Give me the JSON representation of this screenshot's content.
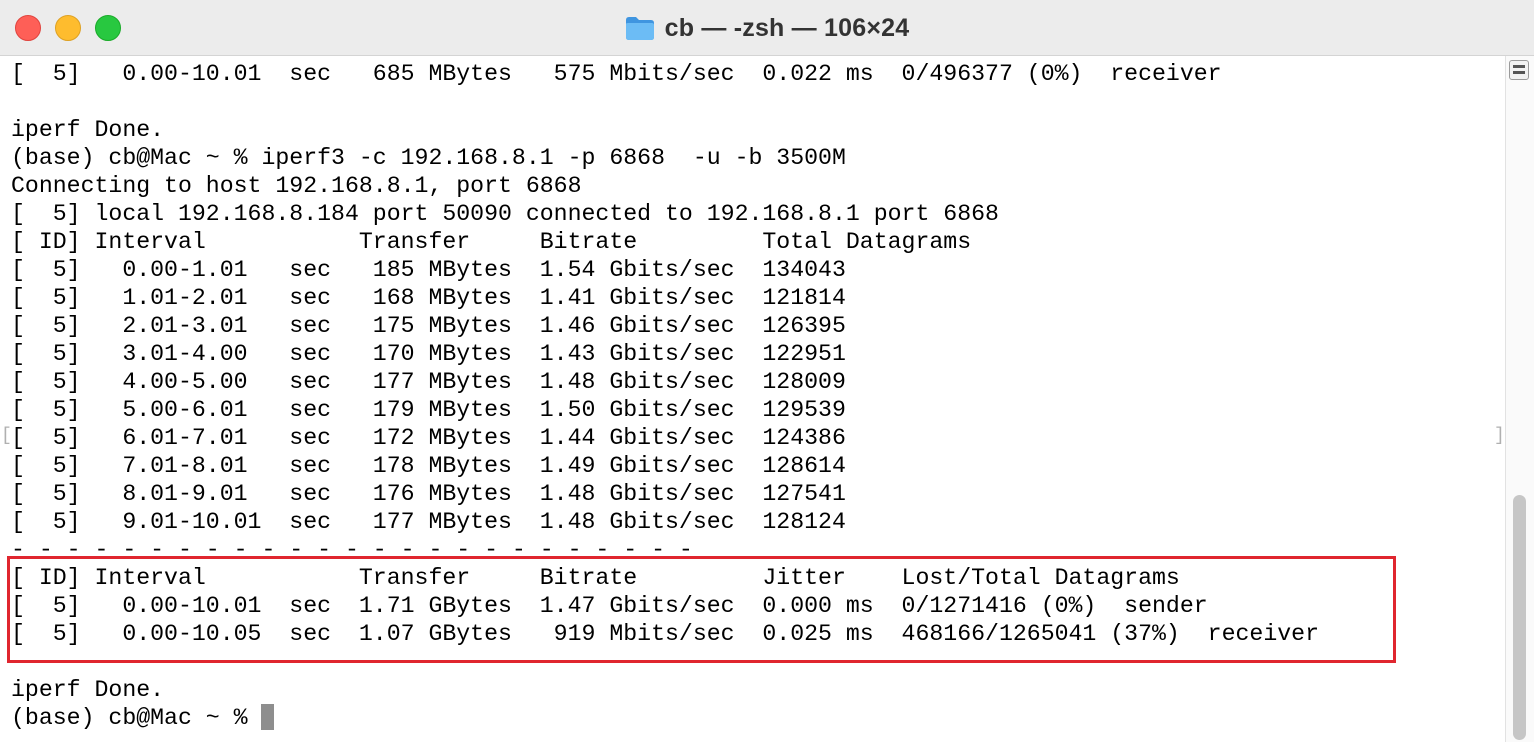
{
  "window": {
    "title": "cb — -zsh — 106×24",
    "icon": "folder-icon"
  },
  "terminal": {
    "lines": [
      "[  5]   0.00-10.01  sec   685 MBytes   575 Mbits/sec  0.022 ms  0/496377 (0%)  receiver",
      "",
      "iperf Done.",
      "(base) cb@Mac ~ % iperf3 -c 192.168.8.1 -p 6868  -u -b 3500M",
      "Connecting to host 192.168.8.1, port 6868",
      "[  5] local 192.168.8.184 port 50090 connected to 192.168.8.1 port 6868",
      "[ ID] Interval           Transfer     Bitrate         Total Datagrams",
      "[  5]   0.00-1.01   sec   185 MBytes  1.54 Gbits/sec  134043",
      "[  5]   1.01-2.01   sec   168 MBytes  1.41 Gbits/sec  121814",
      "[  5]   2.01-3.01   sec   175 MBytes  1.46 Gbits/sec  126395",
      "[  5]   3.01-4.00   sec   170 MBytes  1.43 Gbits/sec  122951",
      "[  5]   4.00-5.00   sec   177 MBytes  1.48 Gbits/sec  128009",
      "[  5]   5.00-6.01   sec   179 MBytes  1.50 Gbits/sec  129539",
      "[  5]   6.01-7.01   sec   172 MBytes  1.44 Gbits/sec  124386",
      "[  5]   7.01-8.01   sec   178 MBytes  1.49 Gbits/sec  128614",
      "[  5]   8.01-9.01   sec   176 MBytes  1.48 Gbits/sec  127541",
      "[  5]   9.01-10.01  sec   177 MBytes  1.48 Gbits/sec  128124",
      "- - - - - - - - - - - - - - - - - - - - - - - - -",
      "[ ID] Interval           Transfer     Bitrate         Jitter    Lost/Total Datagrams",
      "[  5]   0.00-10.01  sec  1.71 GBytes  1.47 Gbits/sec  0.000 ms  0/1271416 (0%)  sender",
      "[  5]   0.00-10.05  sec  1.07 GBytes   919 Mbits/sec  0.025 ms  468166/1265041 (37%)  receiver",
      "",
      "iperf Done."
    ],
    "prompt": "(base) cb@Mac ~ % "
  },
  "annotation": {
    "highlight_color": "#e0262f"
  },
  "colors": {
    "close": "#fe5f57",
    "minimize": "#febc2e",
    "zoom": "#28c840",
    "folder": "#5aaef0",
    "cursor": "#8e8e8e"
  }
}
